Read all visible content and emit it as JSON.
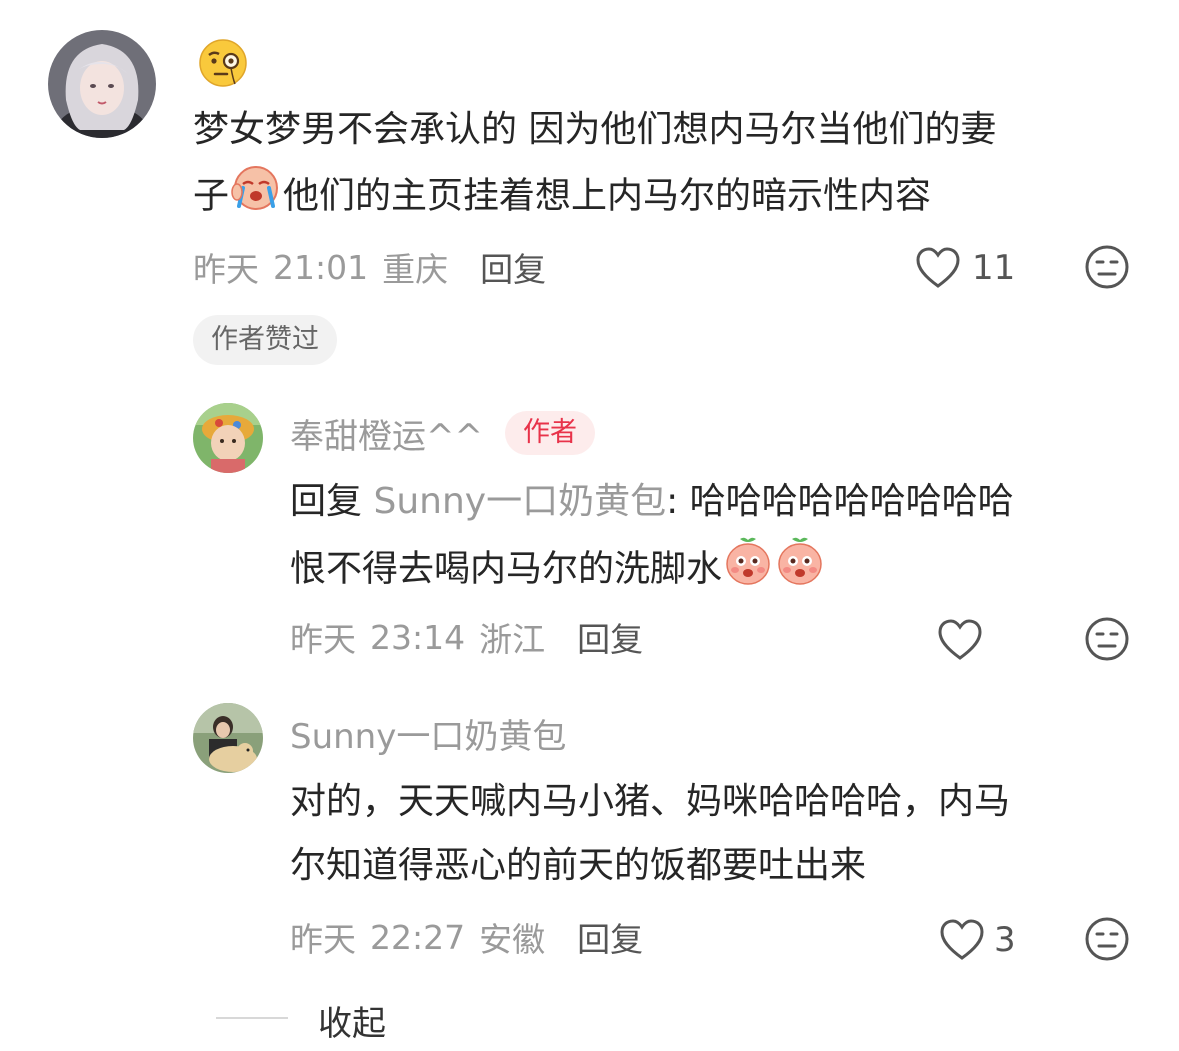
{
  "comment_main": {
    "line1": "梦女梦男不会承认的  因为他们想内马尔当他们的妻",
    "line2_prefix": "子",
    "line2_suffix": "他们的主页挂着想上内马尔的暗示性内容",
    "date": "昨天",
    "time": "21:01",
    "location": "重庆",
    "reply_label": "回复",
    "like_count": "11",
    "author_liked_chip": "作者赞过"
  },
  "reply1": {
    "username": "奉甜橙运^^",
    "badge": "作者",
    "reply_prefix": "回复",
    "reply_to": "Sunny一口奶黄包",
    "colon": ":",
    "line1_text": "哈哈哈哈哈哈哈哈哈",
    "line2_text": "恨不得去喝内马尔的洗脚水",
    "date": "昨天",
    "time": "23:14",
    "location": "浙江",
    "reply_label": "回复"
  },
  "reply2": {
    "username": "Sunny一口奶黄包",
    "line1": "对的，天天喊内马小猪、妈咪哈哈哈哈，内马",
    "line2": "尔知道得恶心的前天的饭都要吐出来",
    "date": "昨天",
    "time": "22:27",
    "location": "安徽",
    "reply_label": "回复",
    "like_count": "3"
  },
  "collapse_label": "收起",
  "colors": {
    "accent": "#e8334a",
    "meta": "#9a9a9a",
    "text": "#262626"
  }
}
